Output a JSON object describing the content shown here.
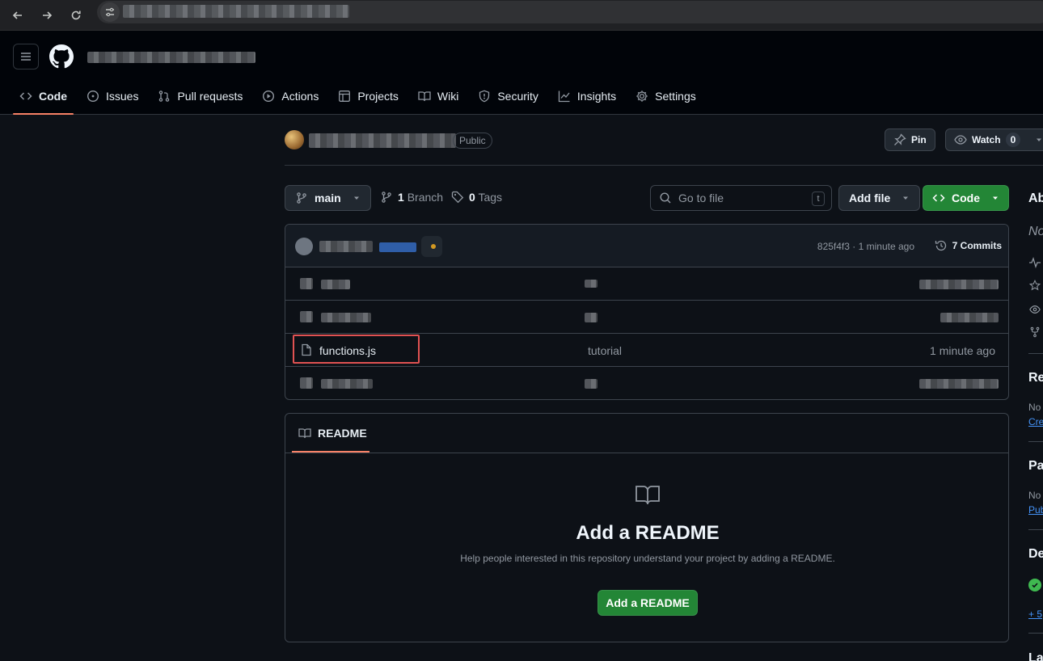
{
  "repo_tabs": [
    {
      "label": "Code",
      "icon": "code-icon"
    },
    {
      "label": "Issues",
      "icon": "issue-icon"
    },
    {
      "label": "Pull requests",
      "icon": "pull-request-icon"
    },
    {
      "label": "Actions",
      "icon": "play-icon"
    },
    {
      "label": "Projects",
      "icon": "table-icon"
    },
    {
      "label": "Wiki",
      "icon": "book-icon"
    },
    {
      "label": "Security",
      "icon": "shield-icon"
    },
    {
      "label": "Insights",
      "icon": "graph-icon"
    },
    {
      "label": "Settings",
      "icon": "gear-icon"
    }
  ],
  "repo": {
    "visibility": "Public",
    "pin_label": "Pin",
    "watch_label": "Watch",
    "watch_count": "0"
  },
  "toolbar": {
    "branch": "main",
    "branch_count": "1",
    "branch_label": "Branch",
    "tag_count": "0",
    "tag_label": "Tags",
    "search_placeholder": "Go to file",
    "search_shortcut": "t",
    "add_file_label": "Add file",
    "code_label": "Code"
  },
  "latest_commit": {
    "meta": "825f4f3 · 1 minute ago",
    "commits_label": "7 Commits"
  },
  "files": [
    {
      "name": "functions.js",
      "message": "tutorial",
      "date": "1 minute ago"
    }
  ],
  "readme": {
    "tab_label": "README",
    "title": "Add a README",
    "description": "Help people interested in this repository understand your project by adding a README.",
    "button_label": "Add a README"
  },
  "sidebar": {
    "about_heading": "Ab",
    "about_desc": "No",
    "releases_heading": "Re",
    "releases_text": "No",
    "releases_link": "Cre",
    "packages_heading": "Pa",
    "packages_text": "No",
    "packages_link": "Pub",
    "deployments_heading": "De",
    "deployments_link": "+ 5",
    "languages_heading": "La"
  },
  "colors": {
    "accent": "#f78166",
    "primary_button": "#238636",
    "highlight": "#e05252"
  }
}
